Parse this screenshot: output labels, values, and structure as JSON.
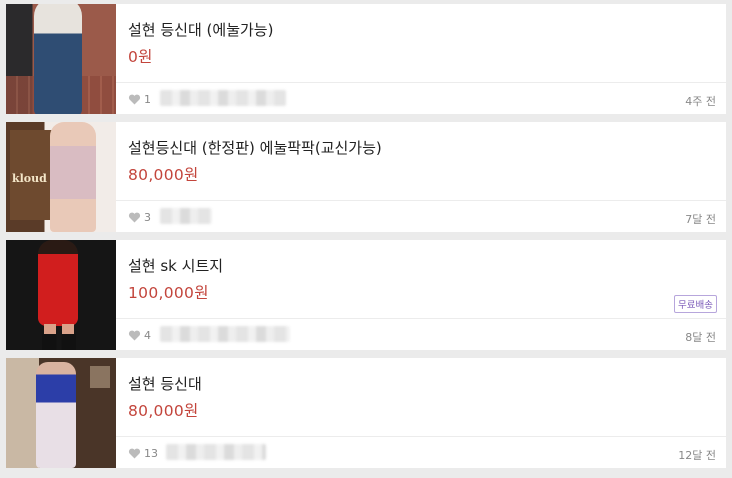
{
  "listings": [
    {
      "title": "설현 등신대 (에눌가능)",
      "price": "0원",
      "likes": "1",
      "time": "4주 전",
      "badge": ""
    },
    {
      "title": "설현등신대 (한정판) 에눌팍팍(교신가능)",
      "price": "80,000원",
      "likes": "3",
      "time": "7달 전",
      "badge": ""
    },
    {
      "title": "설현 sk 시트지",
      "price": "100,000원",
      "likes": "4",
      "time": "8달 전",
      "badge": "무료배송"
    },
    {
      "title": "설현 등신대",
      "price": "80,000원",
      "likes": "13",
      "time": "12달 전",
      "badge": ""
    }
  ],
  "thumbnail_text": {
    "item2_sign": "kloud"
  },
  "icons": {
    "like": "heart-icon"
  },
  "colors": {
    "price": "#c3453c",
    "badge": "#7a5ab8",
    "background": "#ebebeb"
  }
}
